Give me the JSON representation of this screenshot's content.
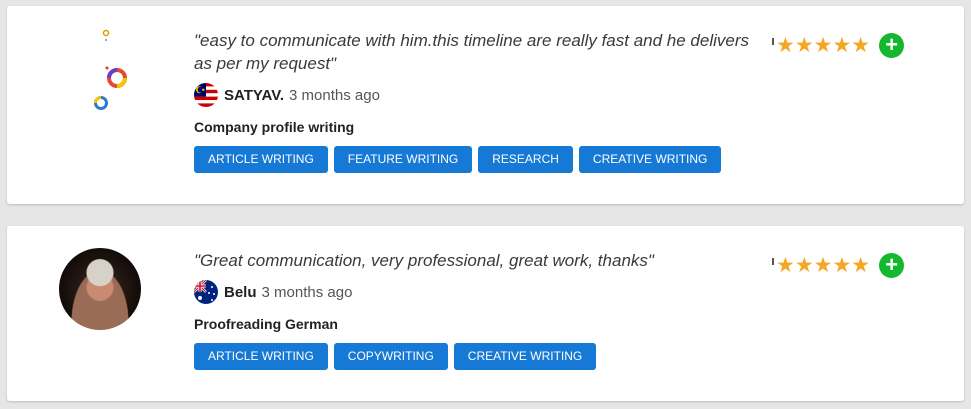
{
  "reviews": [
    {
      "quote": "\"easy to communicate with him.this timeline are really fast and he delivers as per my request\"",
      "reviewer_name": "SATYAV.",
      "time_ago": "3 months ago",
      "flag": "malaysia-flag",
      "project": "Company profile writing",
      "tags": [
        "ARTICLE WRITING",
        "FEATURE WRITING",
        "RESEARCH",
        "CREATIVE WRITING"
      ],
      "stars": "★★★★★",
      "rating": 5,
      "add_label": "+"
    },
    {
      "quote": "\"Great communication, very professional, great work, thanks\"",
      "reviewer_name": "Belu",
      "time_ago": "3 months ago",
      "flag": "australia-flag",
      "project": "Proofreading German",
      "tags": [
        "ARTICLE WRITING",
        "COPYWRITING",
        "CREATIVE WRITING"
      ],
      "stars": "★★★★★",
      "rating": 5,
      "add_label": "+"
    }
  ],
  "colors": {
    "tag_bg": "#1779d6",
    "star": "#f5a623",
    "plus_bg": "#14b82e",
    "page_bg": "#e6e6e6"
  }
}
